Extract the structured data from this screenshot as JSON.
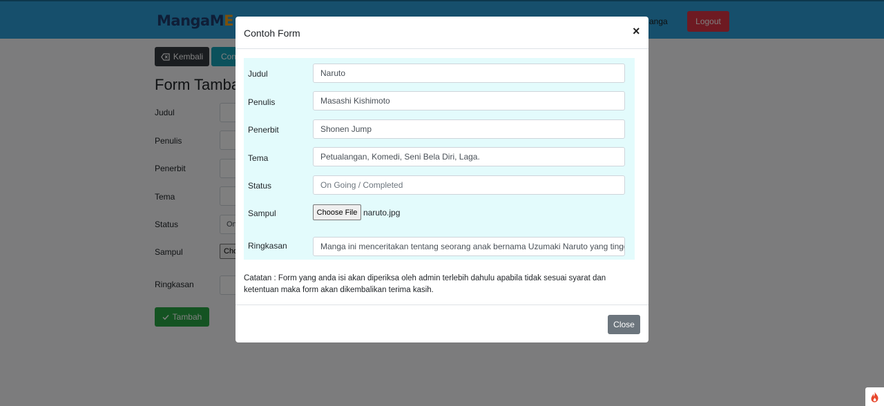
{
  "navbar": {
    "brand_part1": "MangaM",
    "brand_part2": "E",
    "nav_link": "Manga",
    "logout_label": "Logout"
  },
  "page": {
    "back_label": "Kembali",
    "contoh_label": "Contoh Form",
    "title": "Form Tambah",
    "labels": {
      "judul": "Judul",
      "penulis": "Penulis",
      "penerbit": "Penerbit",
      "tema": "Tema",
      "status": "Status",
      "sampul": "Sampul",
      "ringkasan": "Ringkasan"
    },
    "status_placeholder": "On Going / Completed",
    "file_button": "Choose File",
    "submit_label": "Tambah"
  },
  "modal": {
    "title": "Contoh Form",
    "close_symbol": "×",
    "fields": {
      "judul": {
        "label": "Judul",
        "value": "Naruto"
      },
      "penulis": {
        "label": "Penulis",
        "value": "Masashi Kishimoto"
      },
      "penerbit": {
        "label": "Penerbit",
        "value": "Shonen Jump"
      },
      "tema": {
        "label": "Tema",
        "value": "Petualangan, Komedi, Seni Bela Diri, Laga."
      },
      "status": {
        "label": "Status",
        "placeholder": "On Going / Completed"
      },
      "sampul": {
        "label": "Sampul",
        "button": "Choose File",
        "filename": "naruto.jpg"
      },
      "ringkasan": {
        "label": "Ringkasan",
        "value": "Manga ini menceritakan tentang seorang anak bernama Uzumaki Naruto yang tinggal di"
      }
    },
    "note": "Catatan : Form yang anda isi akan diperiksa oleh admin terlebih dahulu apabila tidak sesuai syarat dan ketentuan maka form akan dikembalikan terima kasih.",
    "close_label": "Close"
  },
  "colors": {
    "navbar": "#2d9fd9",
    "danger": "#dc3545",
    "dark": "#343a40",
    "info": "#17a2b8",
    "success": "#28a745",
    "secondary": "#6c757d",
    "form_area": "#e3fbfc"
  },
  "icons": {
    "back": "backspace-icon",
    "info": "info-circle-icon",
    "check": "check-icon",
    "close": "close-icon",
    "fab": "flame-icon"
  }
}
